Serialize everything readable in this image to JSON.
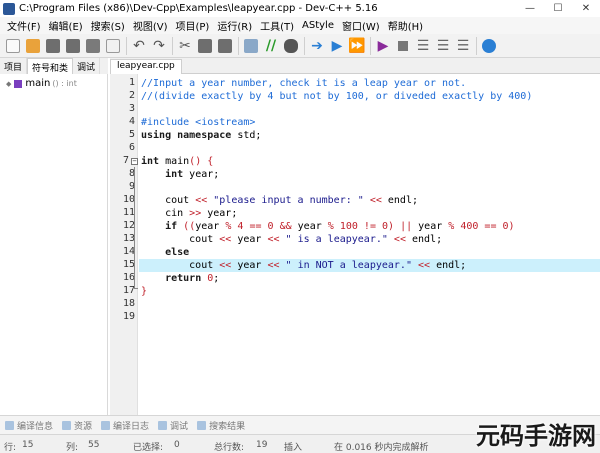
{
  "window": {
    "title": "C:\\Program Files (x86)\\Dev-Cpp\\Examples\\leapyear.cpp - Dev-C++ 5.16",
    "minimize": "—",
    "maximize": "☐",
    "close": "✕"
  },
  "menu": [
    "文件(F)",
    "编辑(E)",
    "搜索(S)",
    "视图(V)",
    "项目(P)",
    "运行(R)",
    "工具(T)",
    "AStyle",
    "窗口(W)",
    "帮助(H)"
  ],
  "toolbar_icons": [
    "new-file-icon",
    "open-folder-icon",
    "save-icon",
    "save-all-icon",
    "close-file-icon",
    "close-all-icon",
    "undo-icon",
    "redo-icon",
    "cut-icon",
    "copy-icon",
    "paste-icon",
    "new-class-icon",
    "comment-icon",
    "find-icon",
    "compile-icon",
    "run-icon",
    "compile-run-icon",
    "debug-icon",
    "stop-icon",
    "indent-icon",
    "unindent-icon",
    "toggle-breakpoint-icon",
    "about-icon"
  ],
  "left_panel": {
    "tabs": [
      "项目",
      "符号和类",
      "调试"
    ],
    "tree_item": {
      "name": "main",
      "type": "() : int"
    }
  },
  "editor": {
    "tab": "leapyear.cpp",
    "line_numbers": [
      "1",
      "2",
      "3",
      "4",
      "5",
      "6",
      "7",
      "8",
      "9",
      "10",
      "11",
      "12",
      "13",
      "14",
      "15",
      "16",
      "17",
      "18",
      "19"
    ]
  },
  "bottom_tabs": [
    "编译信息",
    "资源",
    "编译日志",
    "调试",
    "搜索结果"
  ],
  "status": {
    "line_label": "行:",
    "line": "15",
    "col_label": "列:",
    "col": "55",
    "sel_label": "已选择:",
    "sel": "0",
    "total_label": "总行数:",
    "total": "19",
    "mode": "插入",
    "parse": "在 0.016 秒内完成解析"
  },
  "watermark": "元码手游网",
  "colors": {
    "comment": "#1e6bd6",
    "operator": "#c0202a",
    "highlight_line": "#ccf0fc"
  }
}
